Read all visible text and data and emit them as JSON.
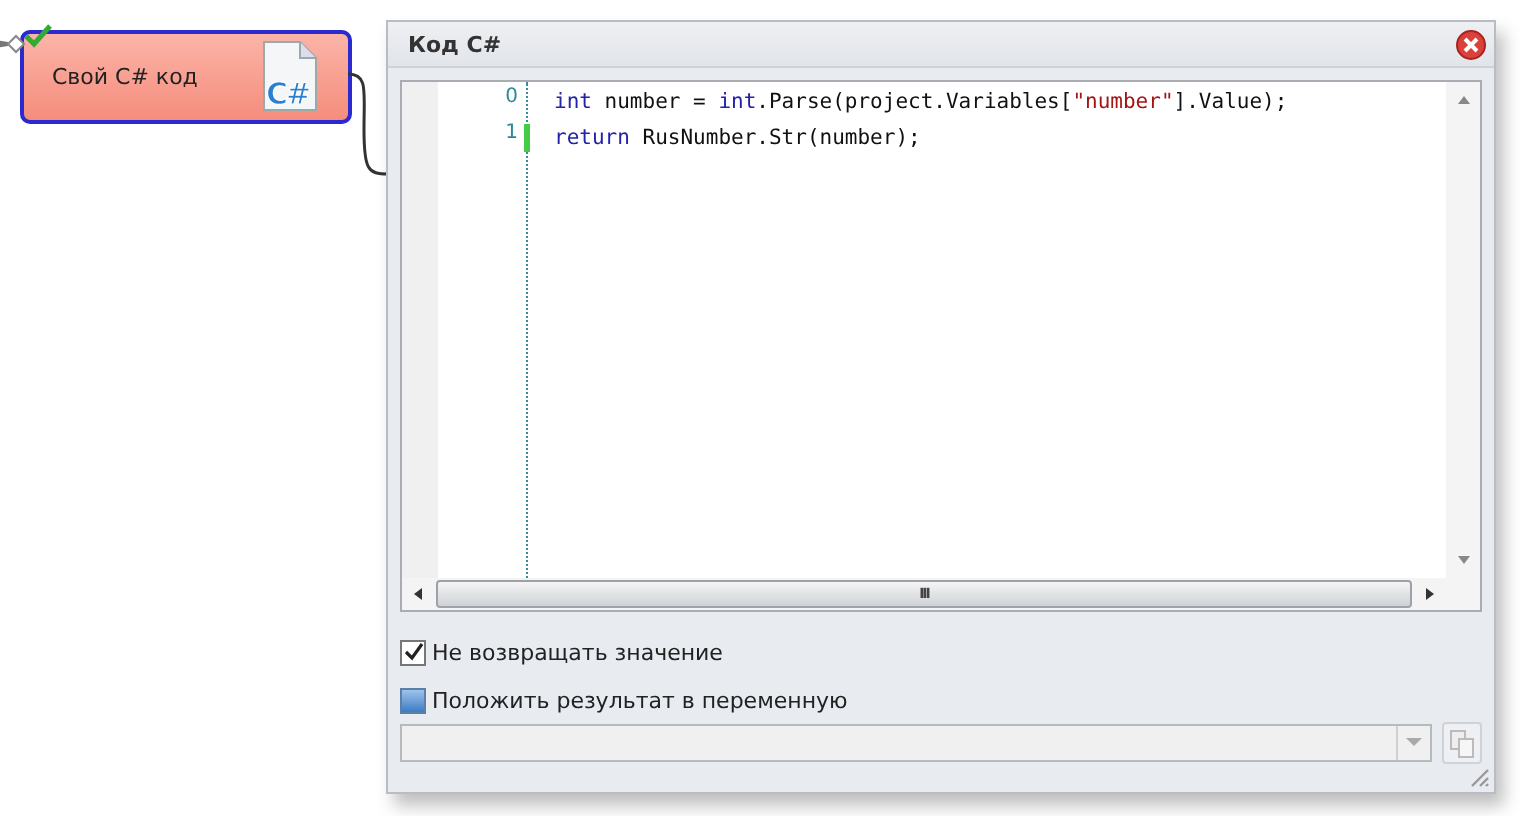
{
  "node": {
    "title": "Свой C# код",
    "icon_text": "C#",
    "validated": true
  },
  "dialog": {
    "title": "Код C#",
    "editor": {
      "lines": [
        {
          "number": "0",
          "changed": false,
          "tokens": [
            {
              "kind": "keyword",
              "text": "int"
            },
            {
              "kind": "plain",
              "text": " number = "
            },
            {
              "kind": "keyword",
              "text": "int"
            },
            {
              "kind": "plain",
              "text": ".Parse(project.Variables["
            },
            {
              "kind": "string",
              "text": "\"number\""
            },
            {
              "kind": "plain",
              "text": "].Value);"
            }
          ]
        },
        {
          "number": "1",
          "changed": true,
          "tokens": [
            {
              "kind": "keyword",
              "text": "return"
            },
            {
              "kind": "plain",
              "text": " RusNumber.Str(number);"
            }
          ]
        }
      ],
      "scroll_glyph": "III"
    },
    "options": [
      {
        "label": "Не возвращать значение",
        "checked": true
      },
      {
        "label": "Положить результат в переменную",
        "checked": false
      }
    ],
    "variable": {
      "disabled": true
    }
  }
}
